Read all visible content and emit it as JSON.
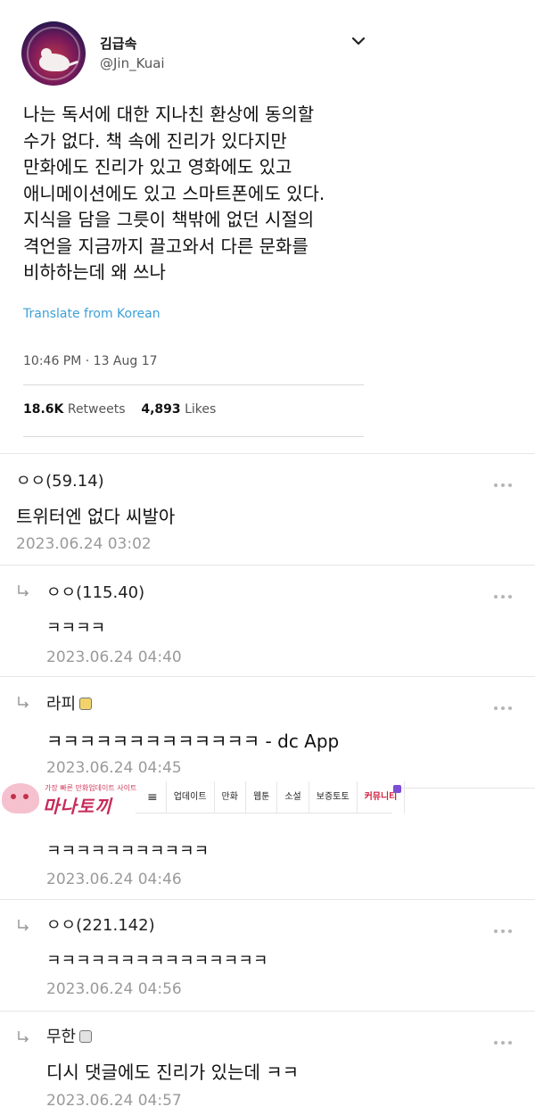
{
  "tweet": {
    "display_name": "김급속",
    "handle": "@Jin_Kuai",
    "text_lines": [
      "나는 독서에 대한 지나친 환상에 동의할",
      "수가 없다. 책 속에 진리가 있다지만",
      "만화에도 진리가 있고 영화에도 있고",
      "애니메이션에도 있고 스마트폰에도 있다.",
      "지식을 담을 그릇이 책밖에 없던 시절의",
      "격언을 지금까지 끌고와서 다른 문화를",
      "비하하는데 왜 쓰나"
    ],
    "translate_label": "Translate from Korean",
    "timestamp": "10:46 PM · 13 Aug 17",
    "retweets_count": "18.6K",
    "retweets_label": "Retweets",
    "likes_count": "4,893",
    "likes_label": "Likes"
  },
  "comments": [
    {
      "author": "ㅇㅇ(59.14)",
      "body": "트위터엔 없다 씨발아",
      "date": "2023.06.24 03:02",
      "reply": false
    },
    {
      "author": "ㅇㅇ(115.40)",
      "body": "ㅋㅋㅋㅋ",
      "date": "2023.06.24 04:40",
      "reply": true
    },
    {
      "author": "라피",
      "body": "ㅋㅋㅋㅋㅋㅋㅋㅋㅋㅋㅋㅋㅋ - dc App",
      "date": "2023.06.24 04:45",
      "reply": true,
      "badge": "gold"
    },
    {
      "author": "",
      "body": "ㅋㅋㅋㅋㅋㅋㅋㅋㅋㅋㅋ",
      "date": "2023.06.24 04:46",
      "reply": true
    },
    {
      "author": "ㅇㅇ(221.142)",
      "body": "ㅋㅋㅋㅋㅋㅋㅋㅋㅋㅋㅋㅋㅋㅋㅋ",
      "date": "2023.06.24 04:56",
      "reply": true
    },
    {
      "author": "무한",
      "body": "디시 댓글에도 진리가 있는데 ㅋㅋ",
      "date": "2023.06.24 04:57",
      "reply": true,
      "badge": "gray"
    }
  ],
  "overlay": {
    "logo_tagline": "가장 빠른 만화업데이트 사이트",
    "logo_text": "마나토끼",
    "menu_icon": "≡",
    "nav_items": [
      "업데이트",
      "만화",
      "웹툰",
      "소설",
      "보증토토",
      "커뮤니티"
    ]
  },
  "colors": {
    "link": "#3ba0d8",
    "date_gray": "#9a9a9a",
    "nav_active": "#d21f3c"
  }
}
